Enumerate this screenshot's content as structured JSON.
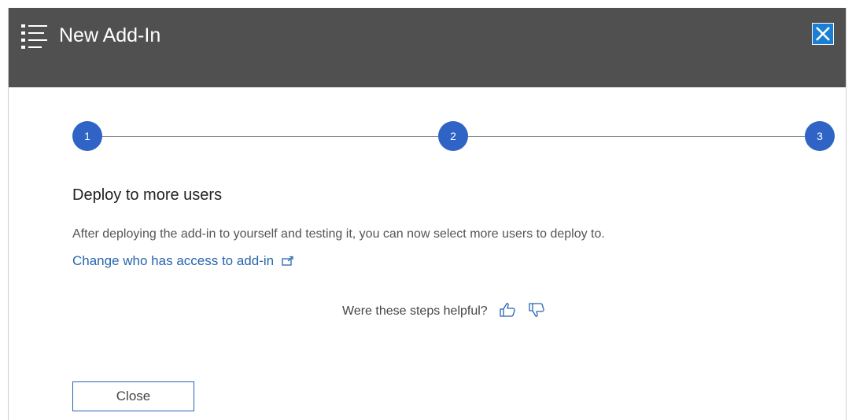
{
  "header": {
    "title": "New Add-In",
    "icon": "list-icon",
    "close_icon": "close-icon",
    "background_color": "#505050",
    "close_color": "#1a7fd4"
  },
  "stepper": {
    "accent_color": "#2f63c6",
    "steps": [
      {
        "label": "1"
      },
      {
        "label": "2"
      },
      {
        "label": "3"
      }
    ]
  },
  "content": {
    "heading": "Deploy to more users",
    "description": "After deploying the add-in to yourself and testing it, you can now select more users to deploy to.",
    "link_text": "Change who has access to add-in",
    "link_icon": "external-link-icon",
    "link_color": "#2566b0"
  },
  "feedback": {
    "question": "Were these steps helpful?",
    "like_icon": "thumbs-up-icon",
    "dislike_icon": "thumbs-down-icon"
  },
  "footer": {
    "close_label": "Close"
  }
}
